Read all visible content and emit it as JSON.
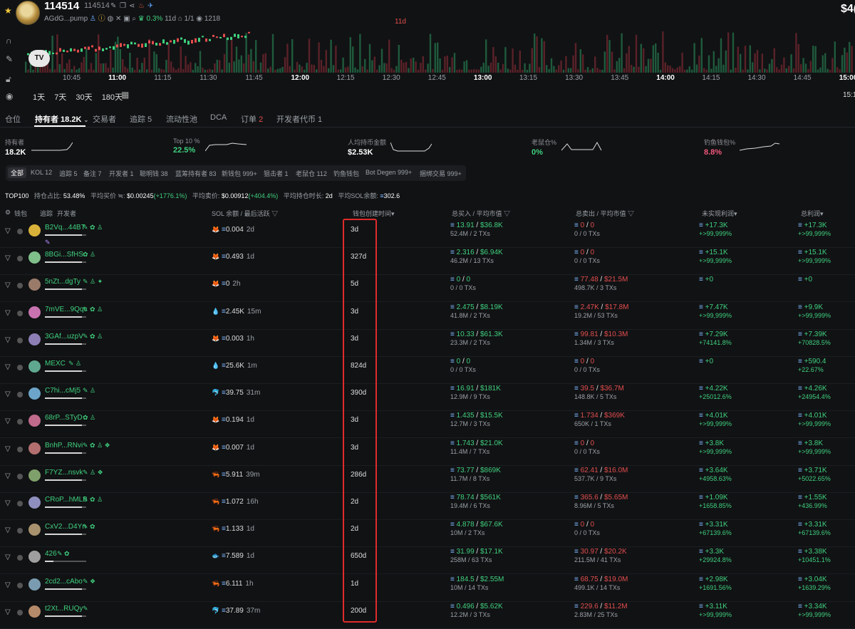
{
  "header": {
    "token_name": "114514",
    "token_name_small": "114514",
    "age": "11d",
    "contract": "AGdG...pump",
    "change_pct": "0.3%",
    "change_age": "11d",
    "ratio": "1/1",
    "views": "1218",
    "price_partial": "$4("
  },
  "chart": {
    "time_labels": [
      "10:45",
      "11:00",
      "11:15",
      "11:30",
      "11:45",
      "12:00",
      "12:15",
      "12:30",
      "12:45",
      "13:00",
      "13:15",
      "13:30",
      "13:45",
      "14:00",
      "14:15",
      "14:30",
      "14:45",
      "15:00"
    ],
    "bold_labels": [
      "11:00",
      "12:00",
      "13:00",
      "14:00",
      "15:00"
    ],
    "ranges": [
      "1天",
      "7天",
      "30天",
      "180天"
    ],
    "right_time": "15:1"
  },
  "tabs": [
    {
      "label": "仓位"
    },
    {
      "label": "持有者 18.2K"
    },
    {
      "label": "交易者"
    },
    {
      "label": "追踪 5"
    },
    {
      "label": "流动性池"
    },
    {
      "label": "DCA"
    },
    {
      "label": "订单",
      "count": "2"
    },
    {
      "label": "开发者代币 1"
    }
  ],
  "stats": [
    {
      "label": "持有者",
      "value": "18.2K",
      "color": "#ffffff"
    },
    {
      "label": "Top 10 %",
      "value": "22.5%",
      "color": "#3fd07e"
    },
    {
      "label": "人均持币金额",
      "value": "$2.53K",
      "color": "#ffffff"
    },
    {
      "label": "老鼠仓%",
      "value": "0%",
      "color": "#3fd07e"
    },
    {
      "label": "钓鱼钱包%",
      "value": "8.8%",
      "color": "#f0577a"
    }
  ],
  "filters": [
    "全部",
    "KOL 12",
    "追踪 5",
    "备注 7",
    "开发者 1",
    "聪明钱 38",
    "蓝筹持有者 83",
    "新钱包 999+",
    "狙击者 1",
    "老鼠仓 112",
    "钓鱼钱包",
    "Bot Degen 999+",
    "捆绑交易 999+"
  ],
  "summary": {
    "top_label": "TOP100",
    "hold_label": "持仓占比:",
    "hold_val": "53.48%",
    "avg_buy_label": "平均买价 ≒:",
    "avg_buy_val": "$0.00245",
    "avg_buy_pct": "(+1776.1%)",
    "avg_sell_label": "平均卖价:",
    "avg_sell_val": "$0.00912",
    "avg_sell_pct": "(+404.4%)",
    "avg_hold_label": "平均持仓时长:",
    "avg_hold_val": "2d",
    "avg_sol_label": "平均SOL余额:",
    "avg_sol_val": "302.6"
  },
  "columns": {
    "wallet": "钱包",
    "track": "追踪",
    "dev": "开发者",
    "sol": "SOL 余额 / 最后活跃",
    "created": "钱包创建时间",
    "bought": "总买入 / 平均市值",
    "sold": "总卖出 / 平均市值",
    "unrealized": "未实现利润",
    "total": "总利润"
  },
  "rows": [
    {
      "addr": "B2Vq...44BT",
      "bar": 0.9,
      "tags": "✎ ✿ ♙",
      "pen2": "✎",
      "src": "🦊",
      "sol": "0.004",
      "last": "2d",
      "created": "3d",
      "buy": "13.91",
      "buy_mc": "$36.8K",
      "buy_sub": "52.4M / 2 TXs",
      "sell": "0",
      "sell_mc": "0",
      "sell_sub": "0 / 0 TXs",
      "unreal": "+17.3K",
      "unreal_pct": "+>99,999%",
      "total": "+17.3K",
      "total_pct": "+>99,999%",
      "av": "#d9b23a"
    },
    {
      "addr": "8BGi...SfHS",
      "bar": 0.9,
      "tags": "✿ ♙",
      "src": "🦊",
      "sol": "0.493",
      "last": "1d",
      "created": "327d",
      "buy": "2.316",
      "buy_mc": "$6.94K",
      "buy_sub": "46.2M / 13 TXs",
      "sell": "0",
      "sell_mc": "0",
      "sell_sub": "0 / 0 TXs",
      "unreal": "+15.1K",
      "unreal_pct": "+>99,999%",
      "total": "+15.1K",
      "total_pct": "+>99,999%",
      "av": "#7fbf8a"
    },
    {
      "addr": "5nZt...dgTy",
      "bar": 0.9,
      "tags": "✎ ♙ ✦",
      "src": "🦊",
      "sol": "0",
      "last": "2h",
      "created": "5d",
      "buy": "0",
      "buy_mc": "0",
      "buy_sub": "0 / 0 TXs",
      "sell": "77.48",
      "sell_mc": "$21.5M",
      "sell_sub": "498.7K / 3 TXs",
      "unreal": "+0",
      "unreal_pct": "",
      "total": "+0",
      "total_pct": "",
      "av": "#9a7b6a"
    },
    {
      "addr": "7mVE...9Qqc",
      "bar": 0.9,
      "tags": "✎ ✿ ♙",
      "src": "💧",
      "sol": "2.45K",
      "last": "15m",
      "created": "3d",
      "buy": "2.475",
      "buy_mc": "$8.19K",
      "buy_sub": "41.8M / 2 TXs",
      "sell": "2.47K",
      "sell_mc": "$17.8M",
      "sell_sub": "19.2M / 53 TXs",
      "unreal": "+7.47K",
      "unreal_pct": "+>99,999%",
      "total": "+9.9K",
      "total_pct": "+>99,999%",
      "av": "#c873b0"
    },
    {
      "addr": "3GAf...uzpV",
      "bar": 0.9,
      "tags": "✎ ✿ ♙",
      "src": "🦊",
      "sol": "0.003",
      "last": "1h",
      "created": "3d",
      "buy": "10.33",
      "buy_mc": "$61.3K",
      "buy_sub": "23.3M / 2 TXs",
      "sell": "99.81",
      "sell_mc": "$10.3M",
      "sell_sub": "1.34M / 3 TXs",
      "unreal": "+7.29K",
      "unreal_pct": "+74141.8%",
      "total": "+7.39K",
      "total_pct": "+70828.5%",
      "av": "#8d7fb5"
    },
    {
      "addr": "MEXC",
      "bar": 0.9,
      "tags": "✎ ♙",
      "src": "💧",
      "sol": "25.6K",
      "last": "1m",
      "created": "824d",
      "buy": "0",
      "buy_mc": "0",
      "buy_sub": "0 / 0 TXs",
      "sell": "0",
      "sell_mc": "0",
      "sell_sub": "0 / 0 TXs",
      "unreal": "+0",
      "unreal_pct": "",
      "total": "+590.4",
      "total_pct": "+22.67%",
      "av": "#5fa88f"
    },
    {
      "addr": "C7hi...cMj5",
      "bar": 0.9,
      "tags": "✎ ♙",
      "src": "🐬",
      "sol": "39.75",
      "last": "31m",
      "created": "390d",
      "buy": "16.91",
      "buy_mc": "$181K",
      "buy_sub": "12.9M / 9 TXs",
      "sell": "39.5",
      "sell_mc": "$36.7M",
      "sell_sub": "148.8K / 5 TXs",
      "unreal": "+4.22K",
      "unreal_pct": "+25012.6%",
      "total": "+4.26K",
      "total_pct": "+24954.4%",
      "av": "#6ca5c9"
    },
    {
      "addr": "68rP...STyD",
      "bar": 0.9,
      "tags": "✿ ♙",
      "src": "🦊",
      "sol": "0.194",
      "last": "1d",
      "created": "3d",
      "buy": "1.435",
      "buy_mc": "$15.5K",
      "buy_sub": "12.7M / 3 TXs",
      "sell": "1.734",
      "sell_mc": "$369K",
      "sell_sub": "650K / 1 TXs",
      "unreal": "+4.01K",
      "unreal_pct": "+>99,999%",
      "total": "+4.01K",
      "total_pct": "+>99,999%",
      "av": "#c06a8c"
    },
    {
      "addr": "BnhP...RNvi",
      "bar": 0.9,
      "tags": "✎ ✿ ♙ ❖",
      "src": "🦊",
      "sol": "0.007",
      "last": "1d",
      "created": "3d",
      "buy": "1.743",
      "buy_mc": "$21.0K",
      "buy_sub": "11.4M / 7 TXs",
      "sell": "0",
      "sell_mc": "0",
      "sell_sub": "0 / 0 TXs",
      "unreal": "+3.8K",
      "unreal_pct": "+>99,999%",
      "total": "+3.8K",
      "total_pct": "+>99,999%",
      "av": "#b36f6f"
    },
    {
      "addr": "F7YZ...nsvk",
      "bar": 0.9,
      "tags": "✎ ♙ ❖",
      "src": "🦐",
      "sol": "5.911",
      "last": "39m",
      "created": "286d",
      "buy": "73.77",
      "buy_mc": "$869K",
      "buy_sub": "11.7M / 8 TXs",
      "sell": "62.41",
      "sell_mc": "$16.0M",
      "sell_sub": "537.7K / 9 TXs",
      "unreal": "+3.64K",
      "unreal_pct": "+4958.63%",
      "total": "+3.71K",
      "total_pct": "+5022.65%",
      "av": "#7fa06a"
    },
    {
      "addr": "CRoP...hMLB",
      "bar": 0.9,
      "tags": "✎ ✿ ♙",
      "src": "🦐",
      "sol": "1.072",
      "last": "16h",
      "created": "2d",
      "buy": "78.74",
      "buy_mc": "$561K",
      "buy_sub": "19.4M / 6 TXs",
      "sell": "365.6",
      "sell_mc": "$5.65M",
      "sell_sub": "8.96M / 5 TXs",
      "unreal": "+1.09K",
      "unreal_pct": "+1658.85%",
      "total": "+1.55K",
      "total_pct": "+436.99%",
      "av": "#8f8fbf"
    },
    {
      "addr": "CxV2...D4Yn",
      "bar": 0.9,
      "tags": "✎ ✿",
      "src": "🦐",
      "sol": "1.133",
      "last": "1d",
      "created": "2d",
      "buy": "4.878",
      "buy_mc": "$67.6K",
      "buy_sub": "10M / 2 TXs",
      "sell": "0",
      "sell_mc": "0",
      "sell_sub": "0 / 0 TXs",
      "unreal": "+3.31K",
      "unreal_pct": "+67139.6%",
      "total": "+3.31K",
      "total_pct": "+67139.6%",
      "av": "#a8926d"
    },
    {
      "addr": "426",
      "bar": 0.2,
      "tags": "✎   ✿",
      "src": "🐟",
      "sol": "7.589",
      "last": "1d",
      "created": "650d",
      "buy": "31.99",
      "buy_mc": "$17.1K",
      "buy_sub": "258M / 63 TXs",
      "sell": "30.97",
      "sell_mc": "$20.2K",
      "sell_sub": "211.5M / 41 TXs",
      "unreal": "+3.3K",
      "unreal_pct": "+29924.8%",
      "total": "+3.38K",
      "total_pct": "+10451.1%",
      "av": "#9f9f9f"
    },
    {
      "addr": "2cd2...cAbo",
      "bar": 0.9,
      "tags": "✎ ❖",
      "src": "🦐",
      "sol": "6.111",
      "last": "1h",
      "created": "1d",
      "buy": "184.5",
      "buy_mc": "$2.55M",
      "buy_sub": "10M / 14 TXs",
      "sell": "68.75",
      "sell_mc": "$19.0M",
      "sell_sub": "499.1K / 14 TXs",
      "unreal": "+2.98K",
      "unreal_pct": "+1691.56%",
      "total": "+3.04K",
      "total_pct": "+1639.29%",
      "av": "#7a9bb0"
    },
    {
      "addr": "t2Xt...RUQy",
      "bar": 0.9,
      "tags": "✎",
      "src": "🐬",
      "sol": "37.89",
      "last": "37m",
      "created": "200d",
      "buy": "0.496",
      "buy_mc": "$5.62K",
      "buy_sub": "12.2M / 3 TXs",
      "sell": "229.6",
      "sell_mc": "$11.2M",
      "sell_sub": "2.83M / 25 TXs",
      "unreal": "+3.11K",
      "unreal_pct": "+>99,999%",
      "total": "+3.34K",
      "total_pct": "+>99,999%",
      "av": "#b58a6a"
    }
  ],
  "colors": {
    "green": "#3fd07e",
    "red": "#e24d4d",
    "highlight": "#e02b2b"
  }
}
